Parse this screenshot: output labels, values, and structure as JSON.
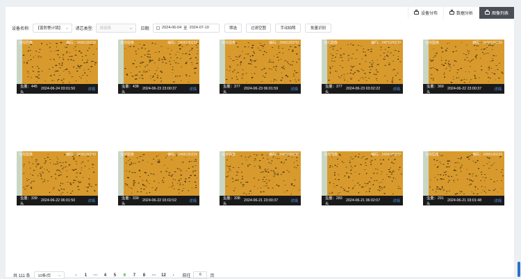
{
  "tabs": [
    {
      "label": "设备分布",
      "icon": "printer-icon",
      "active": false
    },
    {
      "label": "数据分析",
      "icon": "printer-icon",
      "active": false
    },
    {
      "label": "图像列表",
      "icon": "printer-icon",
      "active": true
    }
  ],
  "filters": {
    "device_label": "设备名称:",
    "device_value": "【普防警计镜】",
    "core_label": "诱芯类型:",
    "core_placeholder": "请选择",
    "date_label": "日期:",
    "date_start": "2024-06-04",
    "date_sep": "至",
    "date_end": "2024-07-10",
    "buttons": [
      "筛选",
      "过滤空图",
      "手动拍照",
      "批量识别"
    ]
  },
  "image_watermark": {
    "left": "合规图像",
    "right": "编码：2406180239"
  },
  "cards": [
    {
      "count": "虫量：445头",
      "time": "2024-06-24 03:01:50",
      "detail": "详情"
    },
    {
      "count": "虫量：438头",
      "time": "2024-06-23 23:00:37",
      "detail": "详情"
    },
    {
      "count": "虫量：377头",
      "time": "2024-06-23 06:01:59",
      "detail": "详情"
    },
    {
      "count": "虫量：377头",
      "time": "2024-06-23 03:02:22",
      "detail": "详情"
    },
    {
      "count": "虫量：369头",
      "time": "2024-06-22 23:00:37",
      "detail": "详情"
    },
    {
      "count": "虫量：339头",
      "time": "2024-06-22 06:01:50",
      "detail": "详情"
    },
    {
      "count": "虫量：339头",
      "time": "2024-06-22 03:02:02",
      "detail": "详情"
    },
    {
      "count": "虫量：338头",
      "time": "2024-06-21 23:00:37",
      "detail": "详情"
    },
    {
      "count": "虫量：283头",
      "time": "2024-06-21 06:02:07",
      "detail": "详情"
    },
    {
      "count": "虫量：291头",
      "time": "2024-06-21 03:01:48",
      "detail": "详情"
    }
  ],
  "pagination": {
    "total": "共 111 条",
    "page_size": "10条/页",
    "prev": "‹",
    "next": "›",
    "pages": [
      "1",
      "···",
      "4",
      "5",
      "6",
      "7",
      "8",
      "···",
      "12"
    ],
    "active_page": "6",
    "goto_prefix": "前往",
    "goto_value": "6",
    "goto_suffix": "页"
  },
  "colors": {
    "accent": "#27b148",
    "link": "#4ea1ff",
    "tab_active": "#4a4f57",
    "trap": "#d89a2c"
  }
}
